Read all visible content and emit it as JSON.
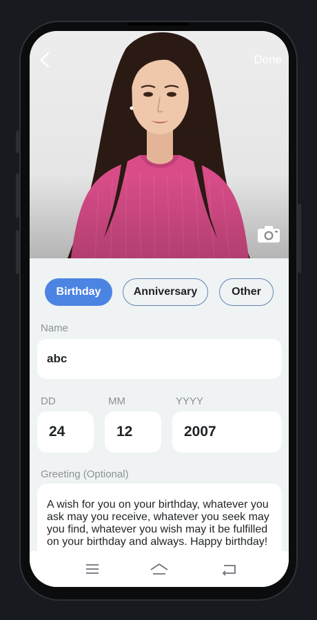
{
  "header": {
    "back_icon": "chevron-left-icon",
    "done_label": "Done",
    "camera_icon": "camera-icon"
  },
  "photo": {
    "subject": "portrait-photo"
  },
  "tabs": [
    {
      "label": "Birthday",
      "active": true
    },
    {
      "label": "Anniversary",
      "active": false
    },
    {
      "label": "Other",
      "active": false
    }
  ],
  "form": {
    "name_label": "Name",
    "name_value": "abc",
    "dd_label": "DD",
    "dd_value": "24",
    "mm_label": "MM",
    "mm_value": "12",
    "yyyy_label": "YYYY",
    "yyyy_value": "2007",
    "greeting_label": "Greeting (Optional)",
    "greeting_value": "A wish for you on your birthday, whatever you ask may you receive, whatever you seek may you find, whatever you wish may it be fulfilled on your birthday and always. Happy birthday!"
  },
  "navbar": {
    "menu_icon": "menu-icon",
    "home_icon": "home-icon",
    "back_icon": "back-icon"
  },
  "colors": {
    "accent": "#4c84e3",
    "tab_border": "#5f84b8",
    "page_bg": "#f0f3f4",
    "frame_bg": "#171b1f"
  }
}
